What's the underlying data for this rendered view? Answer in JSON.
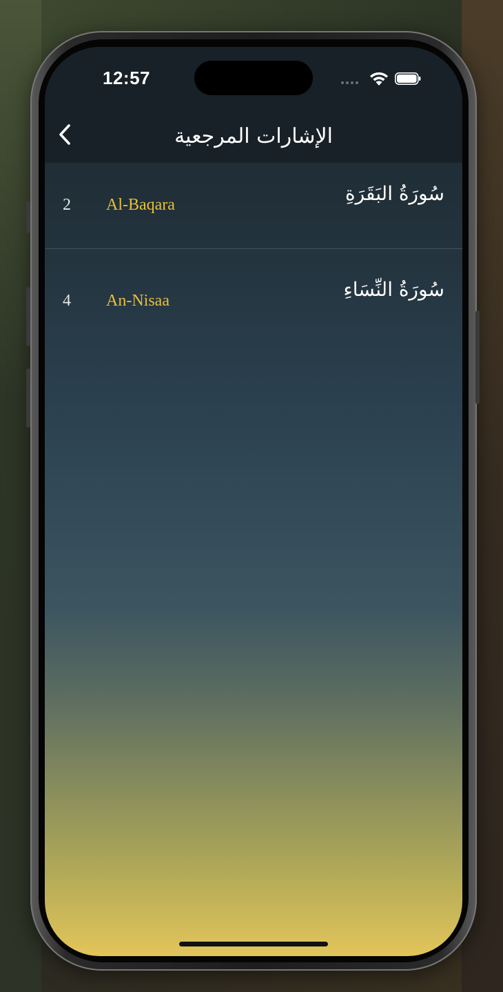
{
  "status_bar": {
    "time": "12:57"
  },
  "nav": {
    "back_icon": "chevron-left-icon",
    "title": "الإشارات المرجعية"
  },
  "bookmarks": [
    {
      "number": "2",
      "latin_name": "Al-Baqara",
      "arabic_name": "سُورَةُ البَقَرَةِ"
    },
    {
      "number": "4",
      "latin_name": "An-Nisaa",
      "arabic_name": "سُورَةُ النِّسَاءِ"
    }
  ],
  "colors": {
    "latin_name": "#e9bf3a",
    "header_bg": "#182128",
    "gradient_bottom": "#e2c55a"
  }
}
